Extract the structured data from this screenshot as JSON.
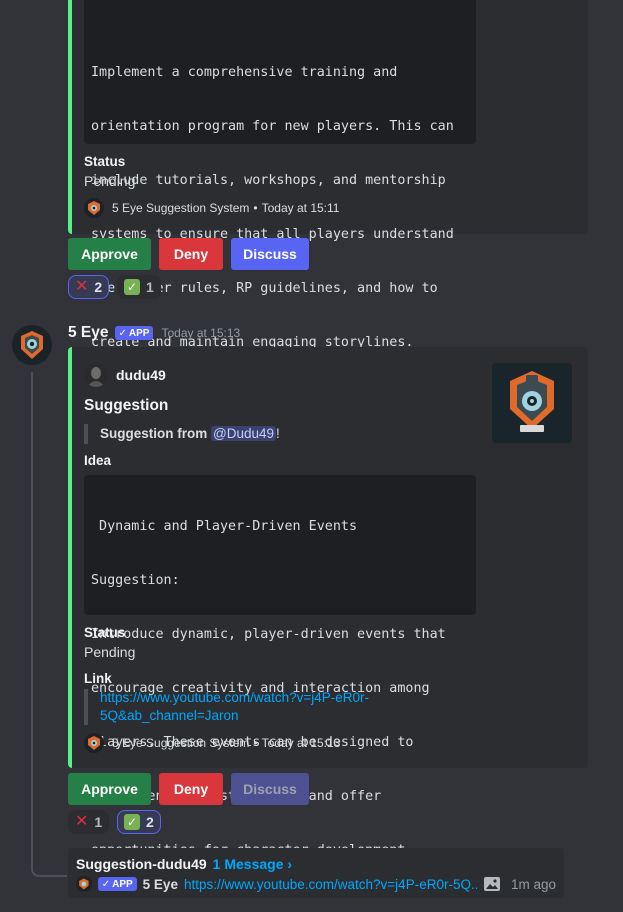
{
  "embed1": {
    "text_lines": [
      "Implement a comprehensive training and",
      "orientation program for new players. This can",
      "include tutorials, workshops, and mentorship",
      "systems to ensure that all players understand",
      "the server rules, RP guidelines, and how to",
      "create and maintain engaging storylines."
    ],
    "status_label": "Status",
    "status_value": "Pending",
    "footer": "5 Eye Suggestion System",
    "footer_sep": "•",
    "footer_time": "Today at 15:11"
  },
  "buttons1": {
    "approve": "Approve",
    "deny": "Deny",
    "discuss": "Discuss"
  },
  "reactions1": {
    "x_count": "2",
    "check_count": "1"
  },
  "message2": {
    "author": "5 Eye",
    "app_tag": "APP",
    "timestamp": "Today at 15:13"
  },
  "embed2": {
    "author": "dudu49",
    "title": "Suggestion",
    "quote_prefix": "Suggestion from ",
    "quote_mention": "@Dudu49",
    "quote_suffix": "!",
    "idea_label": "Idea",
    "code_lines": [
      " Dynamic and Player-Driven Events",
      "Suggestion:",
      "Introduce dynamic, player-driven events that",
      "encourage creativity and interaction among",
      "players. These events can be designed to",
      "create engaging storylines and offer",
      "opportunities for character development."
    ],
    "status_label": "Status",
    "status_value": "Pending",
    "link_label": "Link",
    "link_line1": "https://www.youtube.com/watch?v=j4P-eR0r-",
    "link_line2": "5Q&ab_channel=Jaron",
    "footer": "5 Eye Suggestion System",
    "footer_sep": "•",
    "footer_time": "Today at 15:13"
  },
  "buttons2": {
    "approve": "Approve",
    "deny": "Deny",
    "discuss": "Discuss"
  },
  "reactions2": {
    "x_count": "1",
    "check_count": "2"
  },
  "thread": {
    "name": "Suggestion-dudu49",
    "count": "1 Message ›",
    "app_tag": "APP",
    "author": "5 Eye",
    "preview": "https://www.youtube.com/watch?v=j4P-eR0r-5Q...",
    "time": "1m ago"
  },
  "colors": {
    "background": "#313338",
    "embed_bg": "#2b2d31",
    "embed_accent": "#57f287",
    "approve": "#248046",
    "deny": "#da373c",
    "discuss": "#5865f2",
    "link": "#00a8fc"
  }
}
